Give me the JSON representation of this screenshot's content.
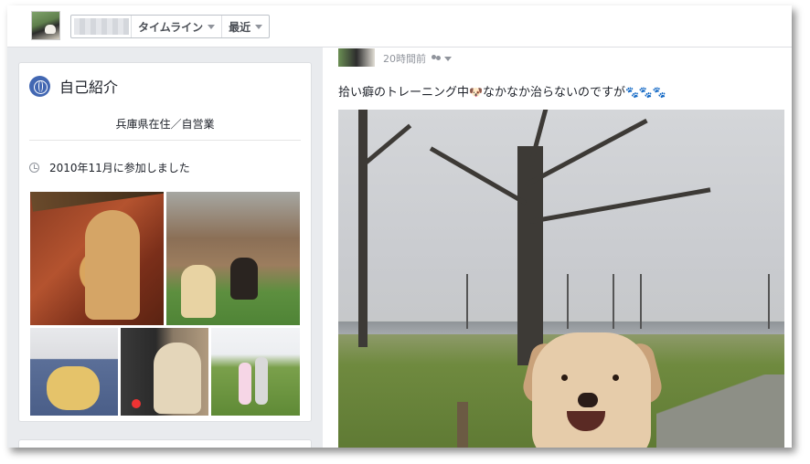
{
  "topbar": {
    "profile_name_redacted": "",
    "timeline_label": "タイムライン",
    "recent_label": "最近"
  },
  "intro": {
    "title": "自己紹介",
    "bio": "兵庫県在住／自営業",
    "joined": "2010年11月に参加しました"
  },
  "post": {
    "time": "20時間前",
    "text_before": "拾い癖のトレーニング中",
    "text_after": "なかなか治らないのですが",
    "emoji_dog": "🐶",
    "emoji_paws": "🐾🐾🐾"
  },
  "colors": {
    "accent": "#4267b2",
    "background": "#e9ebee",
    "text": "#1d2129",
    "muted": "#90949c"
  }
}
